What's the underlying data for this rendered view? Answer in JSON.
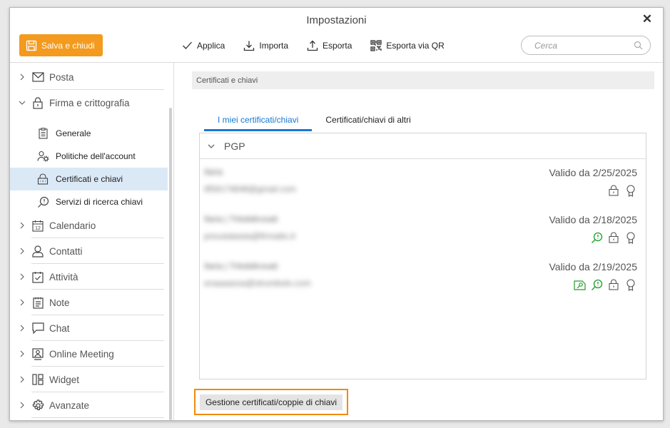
{
  "window": {
    "title": "Impostazioni"
  },
  "toolbar": {
    "save_label": "Salva e chiudi",
    "apply_label": "Applica",
    "import_label": "Importa",
    "export_label": "Esporta",
    "export_qr_label": "Esporta via QR",
    "search_placeholder": "Cerca"
  },
  "sidebar": {
    "posta": "Posta",
    "firma": "Firma e crittografia",
    "sub": {
      "generale": "Generale",
      "politiche": "Politiche dell'account",
      "certificati": "Certificati e chiavi",
      "servizi": "Servizi di ricerca chiavi"
    },
    "calendario": "Calendario",
    "contatti": "Contatti",
    "attivita": "Attività",
    "note": "Note",
    "chat": "Chat",
    "online_meeting": "Online Meeting",
    "widget": "Widget",
    "avanzate": "Avanzate"
  },
  "content": {
    "section_title": "Certificati e chiavi",
    "tab_mine": "I miei certificati/chiavi",
    "tab_others": "Certificati/chiavi di altri",
    "group": "PGP",
    "keys": [
      {
        "name": "Ilaria",
        "email": "ilf59174848@gmail.com",
        "valid": "Valido da 2/25/2025"
      },
      {
        "name": "Ilaria | Tritobilirosati",
        "email": "preustatasta@firmatto.it",
        "valid": "Valido da 2/18/2025"
      },
      {
        "name": "Ilaria | Tritobilirosati",
        "email": "enaaaassa@strumbolo.com",
        "valid": "Valido da 2/19/2025"
      }
    ],
    "manage_label": "Gestione certificati/coppie di chiavi"
  },
  "colors": {
    "accent": "#f39a1f",
    "tab_active": "#1877d2",
    "selected_bg": "#dbe9f7",
    "green_icon": "#1e9e2a"
  }
}
